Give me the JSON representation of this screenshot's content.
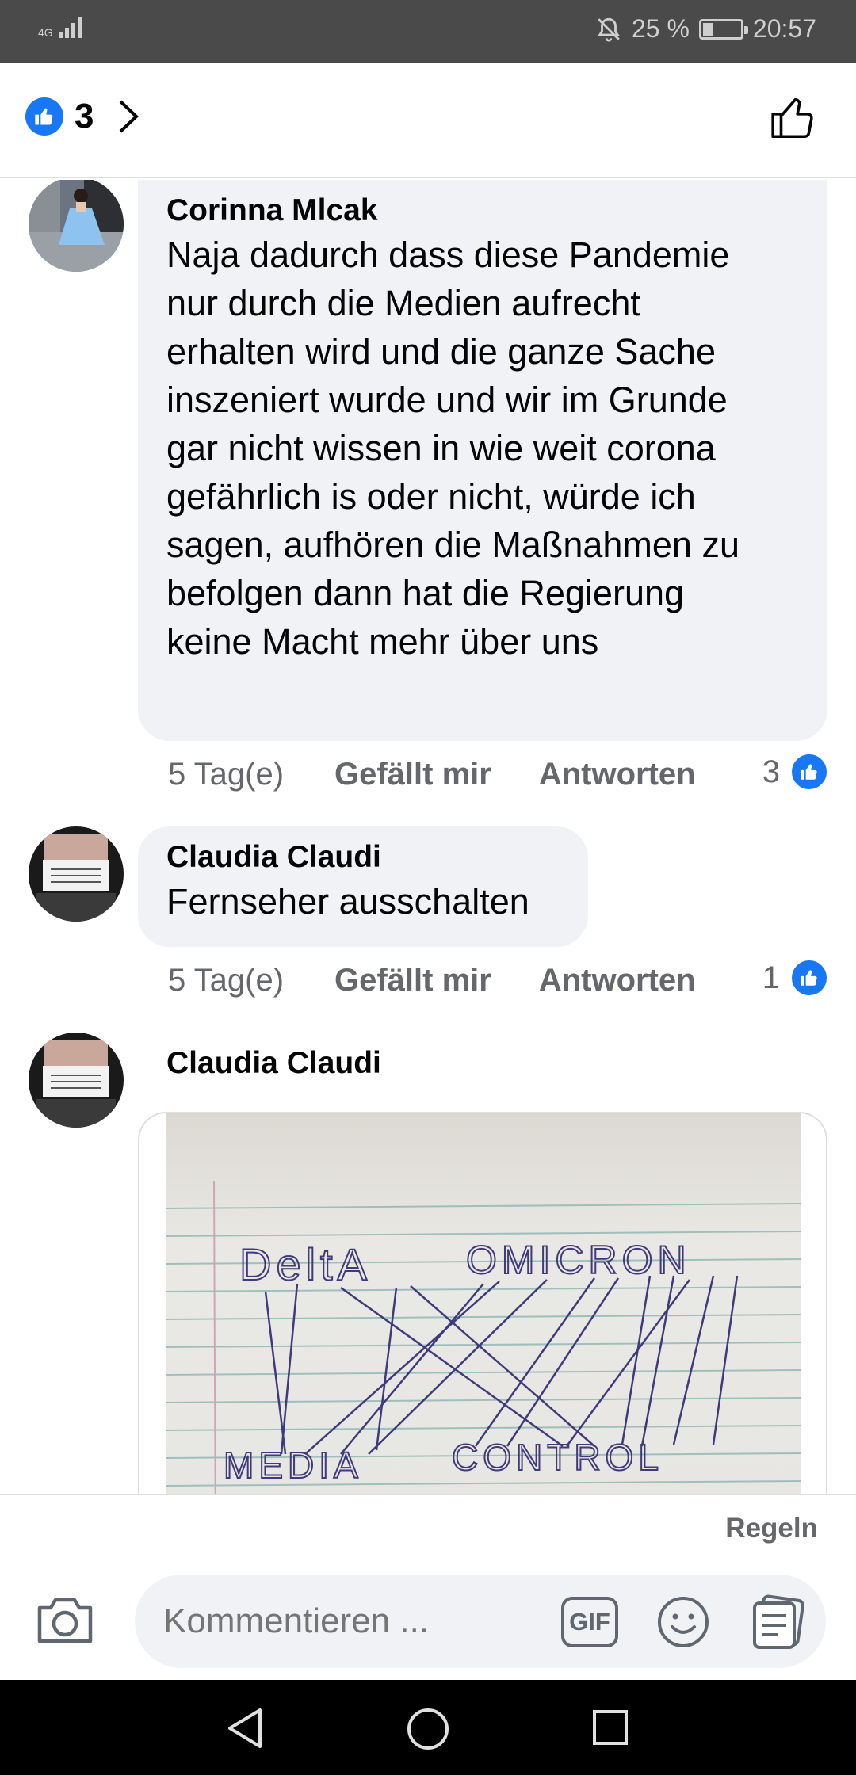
{
  "status_bar": {
    "network": "4G",
    "battery_percent": "25 %",
    "battery_level": 0.25,
    "time": "20:57"
  },
  "header": {
    "reaction_count": "3"
  },
  "comments": [
    {
      "author": "Corinna Mlcak",
      "lines": [
        "Naja dadurch dass diese Pandemie",
        "nur durch die Medien aufrecht",
        "erhalten wird und die ganze Sache",
        "inszeniert wurde und wir im Grunde",
        "gar nicht wissen in wie weit corona",
        "gefährlich is oder nicht, würde ich",
        "sagen, aufhören die Maßnahmen zu",
        "befolgen dann hat die Regierung",
        "keine Macht mehr über uns"
      ],
      "time": "5 Tag(e)",
      "like_label": "Gefällt mir",
      "reply_label": "Antworten",
      "likes": "3"
    },
    {
      "author": "Claudia Claudi",
      "text": "Fernseher ausschalten",
      "time": "5 Tag(e)",
      "like_label": "Gefällt mir",
      "reply_label": "Antworten",
      "likes": "1"
    },
    {
      "author": "Claudia Claudi",
      "image_words": [
        "DeltA",
        "OMICRON",
        "MEDIA",
        "CONTROL"
      ]
    }
  ],
  "footer": {
    "rules_label": "Regeln",
    "input_placeholder": "Kommentieren ...",
    "gif_label": "GIF"
  },
  "colors": {
    "accent": "#1877f2",
    "bubble": "#f0f2f5",
    "muted": "#65676b"
  }
}
